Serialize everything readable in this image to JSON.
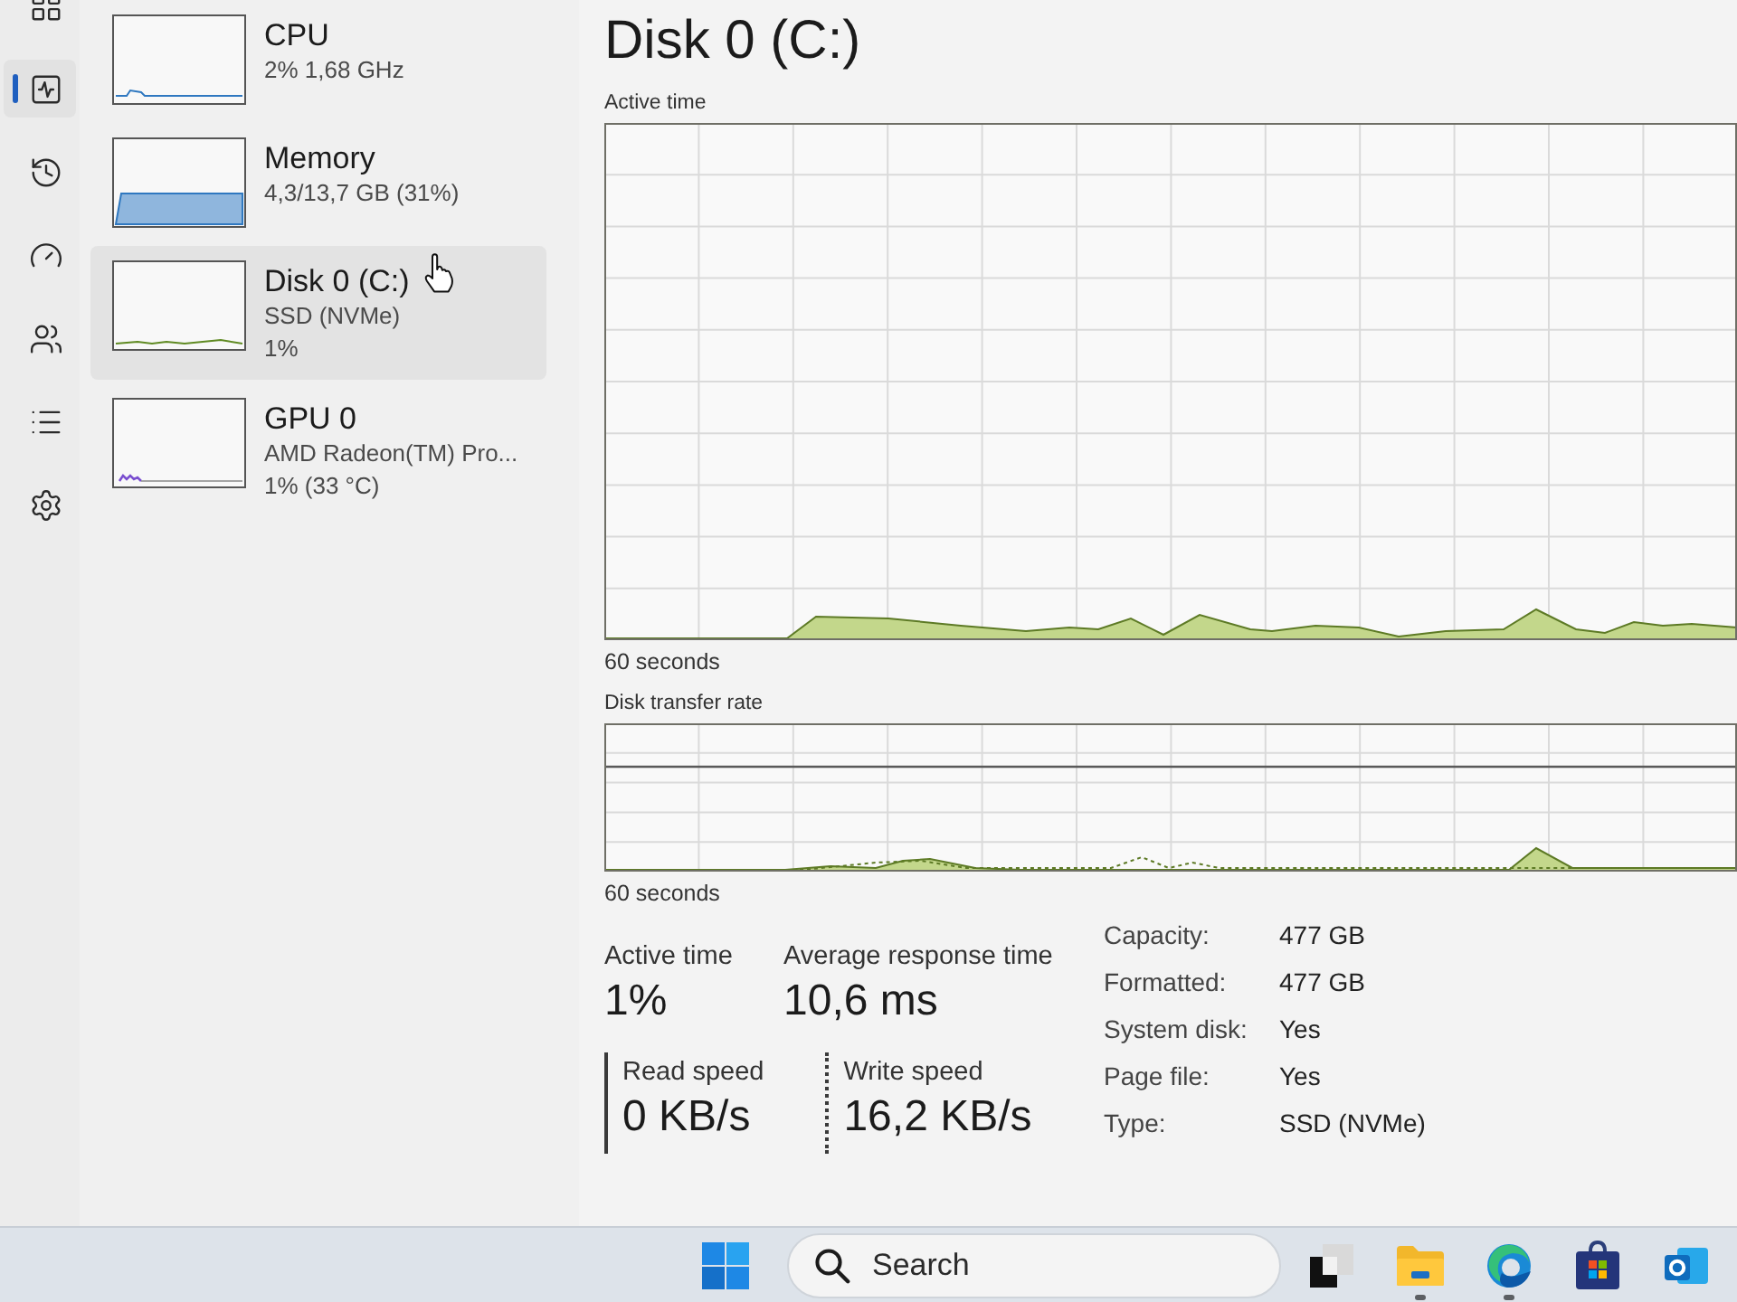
{
  "nav_rail": {
    "items": [
      {
        "kind": "processes",
        "selected": false
      },
      {
        "kind": "performance",
        "selected": true
      },
      {
        "kind": "app_history",
        "selected": false
      },
      {
        "kind": "startup_apps",
        "selected": false
      },
      {
        "kind": "users",
        "selected": false
      },
      {
        "kind": "details",
        "selected": false
      },
      {
        "kind": "services",
        "selected": false
      }
    ]
  },
  "devices": [
    {
      "kind": "cpu",
      "name": "CPU",
      "lines": [
        "2% 1,68 GHz"
      ],
      "selected": false
    },
    {
      "kind": "memory",
      "name": "Memory",
      "lines": [
        "4,3/13,7 GB (31%)"
      ],
      "selected": false
    },
    {
      "kind": "disk",
      "name": "Disk 0 (C:)",
      "lines": [
        "SSD (NVMe)",
        "1%"
      ],
      "selected": true
    },
    {
      "kind": "gpu",
      "name": "GPU 0",
      "lines": [
        "AMD Radeon(TM) Pro...",
        "1% (33 °C)"
      ],
      "selected": false
    }
  ],
  "detail": {
    "title": "Disk 0 (C:)",
    "graphs": [
      {
        "kind": "active_time",
        "label": "Active time",
        "time_span": "60 seconds"
      },
      {
        "kind": "transfer_rate",
        "label": "Disk transfer rate",
        "time_span": "60 seconds"
      }
    ],
    "stats": [
      {
        "label": "Active time",
        "value": "1%"
      },
      {
        "label": "Average response time",
        "value": "10,6 ms"
      }
    ],
    "speeds": [
      {
        "kind": "read",
        "label": "Read speed",
        "value": "0 KB/s"
      },
      {
        "kind": "write",
        "label": "Write speed",
        "value": "16,2 KB/s"
      }
    ],
    "properties": [
      {
        "label": "Capacity:",
        "value": "477 GB"
      },
      {
        "label": "Formatted:",
        "value": "477 GB"
      },
      {
        "label": "System disk:",
        "value": "Yes"
      },
      {
        "label": "Page file:",
        "value": "Yes"
      },
      {
        "label": "Type:",
        "value": "SSD (NVMe)"
      }
    ]
  },
  "taskbar": {
    "search": {
      "placeholder": "Search"
    },
    "apps": [
      {
        "kind": "task_view",
        "running": false
      },
      {
        "kind": "file_explorer",
        "running": true
      },
      {
        "kind": "edge",
        "running": true
      },
      {
        "kind": "store",
        "running": false
      },
      {
        "kind": "outlook",
        "running": false
      }
    ]
  }
}
